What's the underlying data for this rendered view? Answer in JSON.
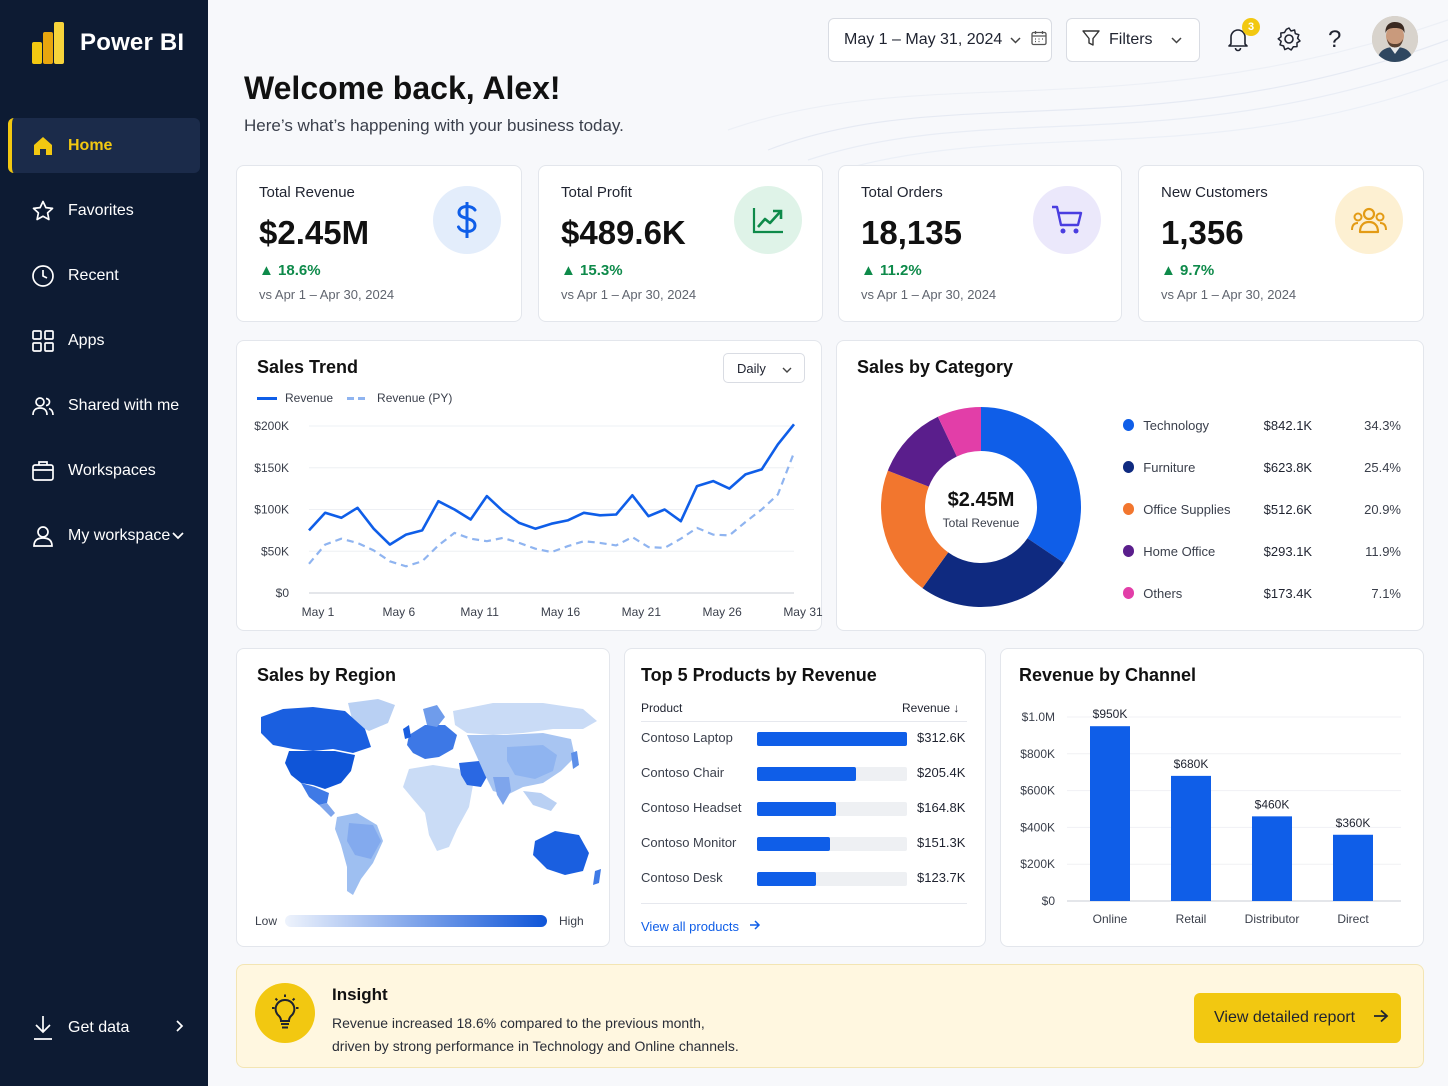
{
  "app": {
    "name": "Power BI"
  },
  "nav": {
    "items": [
      {
        "label": "Home",
        "icon": "home-icon"
      },
      {
        "label": "Favorites",
        "icon": "star-icon"
      },
      {
        "label": "Recent",
        "icon": "clock-icon"
      },
      {
        "label": "Apps",
        "icon": "apps-grid-icon"
      },
      {
        "label": "Shared with me",
        "icon": "people-icon"
      },
      {
        "label": "Workspaces",
        "icon": "briefcase-icon"
      },
      {
        "label": "My workspace",
        "icon": "person-icon"
      }
    ],
    "get_data": "Get data"
  },
  "header": {
    "date_range": "May 1 – May 31, 2024",
    "filters_label": "Filters",
    "notification_count": "3",
    "help_glyph": "?",
    "welcome": "Welcome back, Alex!",
    "subtitle": "Here’s what’s happening with your business today."
  },
  "kpis": [
    {
      "title": "Total Revenue",
      "value": "$2.45M",
      "change": "▲ 18.6%",
      "compare": "vs Apr 1 – Apr 30, 2024",
      "icon": "dollar-icon",
      "icon_bg": "#e3edfb",
      "icon_color": "#0f5ee8"
    },
    {
      "title": "Total Profit",
      "value": "$489.6K",
      "change": "▲ 15.3%",
      "compare": "vs Apr 1 – Apr 30, 2024",
      "icon": "trending-up-icon",
      "icon_bg": "#dff3e8",
      "icon_color": "#0e8a4a"
    },
    {
      "title": "Total Orders",
      "value": "18,135",
      "change": "▲ 11.2%",
      "compare": "vs Apr 1 – Apr 30, 2024",
      "icon": "cart-icon",
      "icon_bg": "#ebe8fb",
      "icon_color": "#4a3de0"
    },
    {
      "title": "New Customers",
      "value": "1,356",
      "change": "▲ 9.7%",
      "compare": "vs Apr 1 – Apr 30, 2024",
      "icon": "customers-icon",
      "icon_bg": "#fdf0d2",
      "icon_color": "#e39b15"
    }
  ],
  "sales_trend": {
    "title": "Sales Trend",
    "granularity": "Daily",
    "legend": [
      "Revenue",
      "Revenue (PY)"
    ],
    "chart_data": {
      "type": "line",
      "x": [
        "May 1",
        "May 2",
        "May 3",
        "May 4",
        "May 5",
        "May 6",
        "May 7",
        "May 8",
        "May 9",
        "May 10",
        "May 11",
        "May 12",
        "May 13",
        "May 14",
        "May 15",
        "May 16",
        "May 17",
        "May 18",
        "May 19",
        "May 20",
        "May 21",
        "May 22",
        "May 23",
        "May 24",
        "May 25",
        "May 26",
        "May 27",
        "May 28",
        "May 29",
        "May 30",
        "May 31"
      ],
      "x_ticks": [
        "May 1",
        "May 6",
        "May 11",
        "May 16",
        "May 21",
        "May 26",
        "May 31"
      ],
      "y_ticks": [
        "$0",
        "$50K",
        "$100K",
        "$150K",
        "$200K"
      ],
      "ylim": [
        0,
        200000
      ],
      "series": [
        {
          "name": "Revenue",
          "values": [
            75000,
            96000,
            90000,
            102000,
            77000,
            58000,
            70000,
            75000,
            110000,
            100000,
            88000,
            116000,
            98000,
            84000,
            77000,
            83000,
            87000,
            96000,
            93000,
            94000,
            117000,
            92000,
            100000,
            86000,
            128000,
            134000,
            125000,
            142000,
            148000,
            178000,
            202000
          ]
        },
        {
          "name": "Revenue (PY)",
          "values": [
            35000,
            58000,
            65000,
            60000,
            51000,
            38000,
            32000,
            38000,
            57000,
            72000,
            65000,
            62000,
            66000,
            60000,
            53000,
            49000,
            56000,
            62000,
            60000,
            57000,
            67000,
            55000,
            54000,
            65000,
            78000,
            70000,
            69000,
            85000,
            100000,
            118000,
            168000
          ]
        }
      ]
    }
  },
  "category": {
    "title": "Sales by Category",
    "center_value": "$2.45M",
    "center_label": "Total Revenue",
    "chart_data": {
      "type": "pie",
      "categories": [
        "Technology",
        "Furniture",
        "Office Supplies",
        "Home Office",
        "Others"
      ],
      "values": [
        842.1,
        623.8,
        512.6,
        293.1,
        173.4
      ],
      "value_labels": [
        "$842.1K",
        "$623.8K",
        "$512.6K",
        "$293.1K",
        "$173.4K"
      ],
      "percent_labels": [
        "34.3%",
        "25.4%",
        "20.9%",
        "11.9%",
        "7.1%"
      ],
      "colors": [
        "#0f5ee8",
        "#0f2a80",
        "#f2762e",
        "#5a1e8c",
        "#e23ea8"
      ]
    }
  },
  "region": {
    "title": "Sales by Region",
    "scale_low": "Low",
    "scale_high": "High"
  },
  "products": {
    "title": "Top 5 Products by Revenue",
    "col_product": "Product",
    "col_revenue": "Revenue",
    "sort_glyph": "↓",
    "link": "View all products",
    "chart_data": {
      "type": "bar",
      "categories": [
        "Contoso Laptop",
        "Contoso Chair",
        "Contoso Headset",
        "Contoso Monitor",
        "Contoso Desk"
      ],
      "values": [
        312.6,
        205.4,
        164.8,
        151.3,
        123.7
      ],
      "value_labels": [
        "$312.6K",
        "$205.4K",
        "$164.8K",
        "$151.3K",
        "$123.7K"
      ]
    }
  },
  "channel": {
    "title": "Revenue by Channel",
    "chart_data": {
      "type": "bar",
      "categories": [
        "Online",
        "Retail",
        "Distributor",
        "Direct"
      ],
      "values": [
        950000,
        680000,
        460000,
        360000
      ],
      "value_labels": [
        "$950K",
        "$680K",
        "$460K",
        "$360K"
      ],
      "y_ticks": [
        "$0",
        "$200K",
        "$400K",
        "$600K",
        "$800K",
        "$1.0M"
      ],
      "ylim": [
        0,
        1000000
      ]
    }
  },
  "insight": {
    "title": "Insight",
    "line1": "Revenue increased 18.6% compared to the previous month,",
    "line2": "driven by strong performance in Technology and Online channels.",
    "button": "View detailed report"
  },
  "colors": {
    "accent": "#f2c811",
    "primary": "#0f5ee8",
    "sidebar": "#0d1b33",
    "positive": "#0e8a4a"
  }
}
